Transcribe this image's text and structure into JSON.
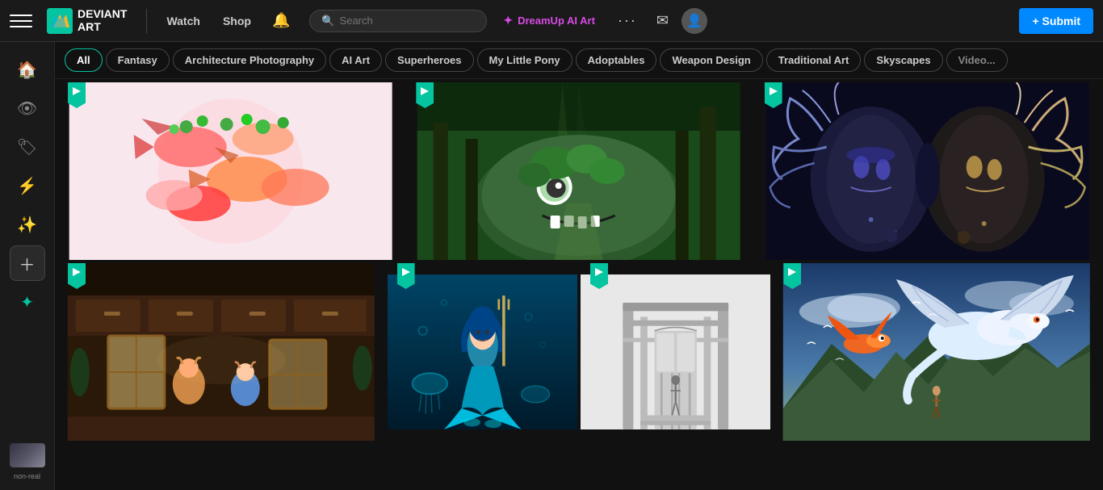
{
  "app": {
    "title": "DeviantArt",
    "logo_text_line1": "DEVIANT",
    "logo_text_line2": "ART"
  },
  "topnav": {
    "watch_label": "Watch",
    "shop_label": "Shop",
    "search_placeholder": "Search",
    "dreamup_label": "DreamUp AI Art",
    "submit_label": "+ Submit"
  },
  "categories": {
    "all_label": "All",
    "items": [
      {
        "label": "All",
        "active": true
      },
      {
        "label": "Fantasy",
        "active": false
      },
      {
        "label": "Architecture Photography",
        "active": false
      },
      {
        "label": "AI Art",
        "active": false
      },
      {
        "label": "Superheroes",
        "active": false
      },
      {
        "label": "My Little Pony",
        "active": false
      },
      {
        "label": "Adoptables",
        "active": false
      },
      {
        "label": "Weapon Design",
        "active": false
      },
      {
        "label": "Traditional Art",
        "active": false
      },
      {
        "label": "Skyscapes",
        "active": false
      },
      {
        "label": "Video Games",
        "active": false
      }
    ]
  },
  "sidenav": {
    "thumbnail_label": "non-real"
  },
  "gallery": {
    "row1": [
      {
        "id": "art1",
        "style": "fish",
        "badge": true
      },
      {
        "id": "art2",
        "style": "forest",
        "badge": true
      },
      {
        "id": "art3",
        "style": "surreal",
        "badge": true
      }
    ],
    "row2": [
      {
        "id": "art4",
        "style": "interior",
        "badge": true
      },
      {
        "id": "art5",
        "style": "mermaid",
        "badge": true
      },
      {
        "id": "art6",
        "style": "sketch",
        "badge": true
      },
      {
        "id": "art7",
        "style": "dragon",
        "badge": true
      }
    ]
  }
}
